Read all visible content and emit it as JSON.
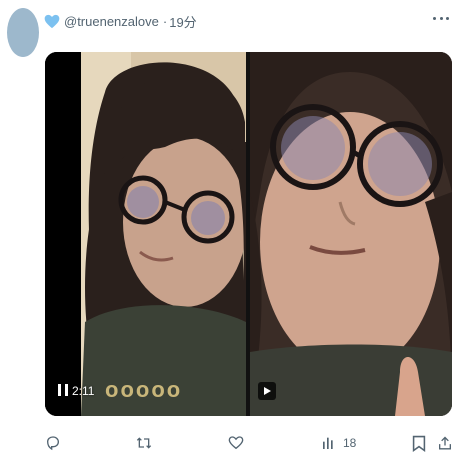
{
  "post": {
    "handle": "@truenenzalove",
    "separator": "·",
    "time_ago": "19分"
  },
  "media": {
    "video1_time": "2:11"
  },
  "actions": {
    "views_count": "18"
  },
  "colors": {
    "heart": "#7cc1f0",
    "avatar": "#9db8cc",
    "muted_text": "#536471"
  },
  "icons": [
    "blue-heart-icon",
    "more-icon",
    "pause-icon",
    "play-icon",
    "reply-icon",
    "repost-icon",
    "like-icon",
    "views-icon",
    "bookmark-icon",
    "share-icon"
  ]
}
